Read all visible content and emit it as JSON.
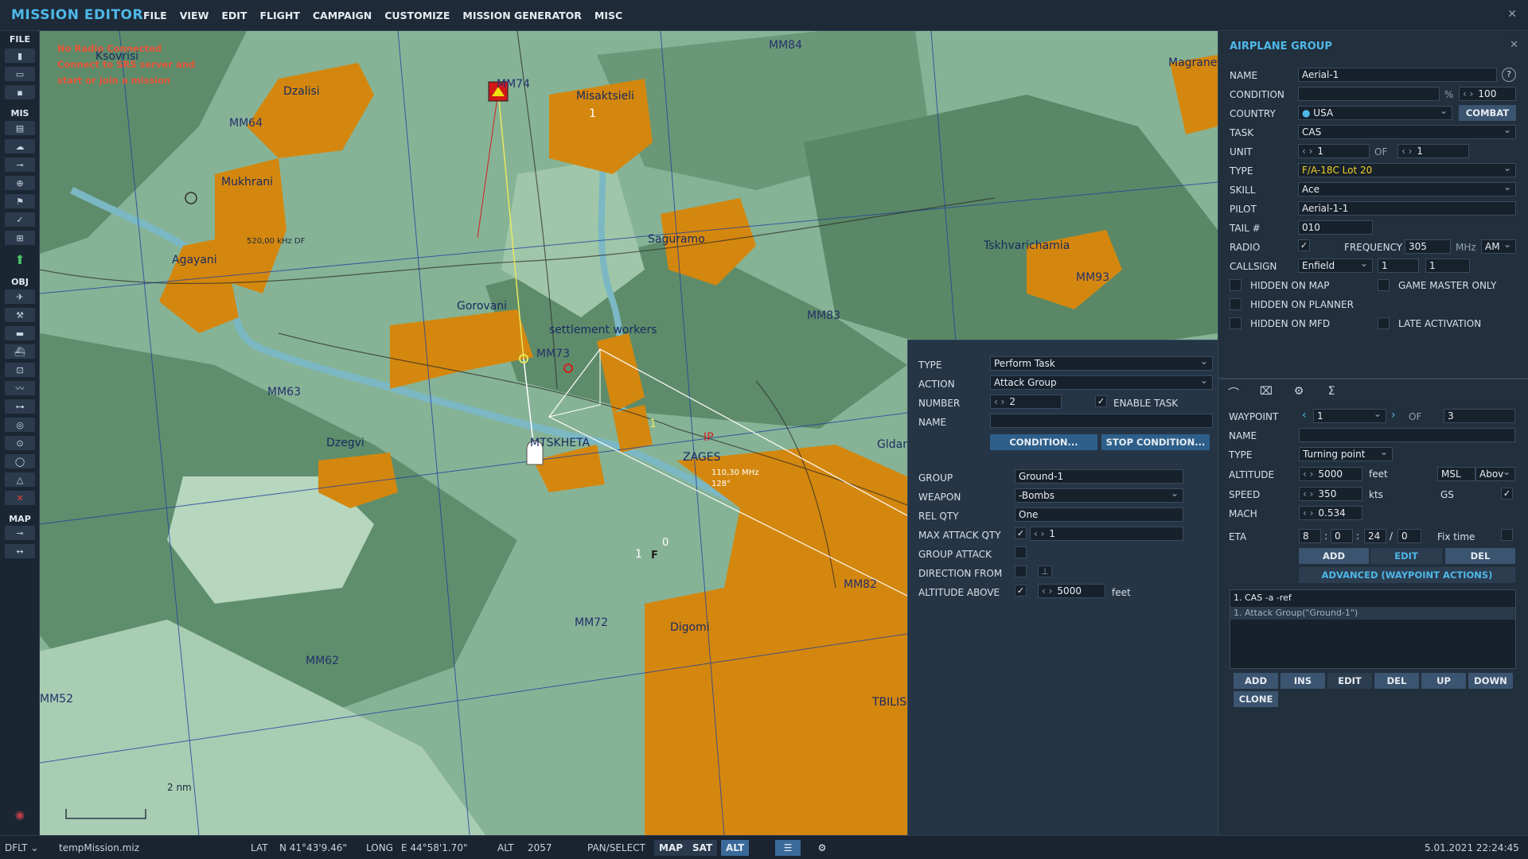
{
  "app": {
    "title": "MISSION EDITOR",
    "close_icon": "close-icon"
  },
  "menu": [
    "FILE",
    "VIEW",
    "EDIT",
    "FLIGHT",
    "CAMPAIGN",
    "CUSTOMIZE",
    "MISSION GENERATOR",
    "MISC"
  ],
  "toolbar": {
    "file_label": "FILE",
    "mis_label": "MIS",
    "obj_label": "OBJ",
    "map_label": "MAP"
  },
  "map": {
    "radio_msg_1": "No Radio Connected",
    "radio_msg_2": "Connect to SRS server and",
    "radio_msg_3": "start or join a mission",
    "towns": [
      "Ksovrisi",
      "Dzalisi",
      "Mukhrani",
      "Agayani",
      "Misaktsieli",
      "Saguramo",
      "Gorovani",
      "settlement workers",
      "Dzegvi",
      "MTSKHETA",
      "ZAGES",
      "Gldani",
      "Digomi",
      "TBILIS",
      "Magraneti",
      "Tskhvarichamia"
    ],
    "grid_labels": [
      "MM84",
      "MM74",
      "MM64",
      "MM83",
      "MM73",
      "MM63",
      "MM93",
      "MM82",
      "MM72",
      "MM62",
      "MM52"
    ],
    "beacon": "520,00 kHz DF",
    "ip_label": "IP",
    "zages_freq": "110,30 MHz",
    "zages_bearing": "128°",
    "wp1_label": "1",
    "wp0_label": "0",
    "start_label": "1",
    "target_label": "1",
    "f_label": "F",
    "scale": "2 nm"
  },
  "group_panel": {
    "title": "AIRPLANE GROUP",
    "name_label": "NAME",
    "name": "Aerial-1",
    "condition_label": "CONDITION",
    "condition": "",
    "percent": "%",
    "condition_pct": "100",
    "country_label": "COUNTRY",
    "country": "USA",
    "combat": "COMBAT",
    "task_label": "TASK",
    "task": "CAS",
    "unit_label": "UNIT",
    "unit": "1",
    "of_label": "OF",
    "unit_of": "1",
    "type_label": "TYPE",
    "type": "F/A-18C Lot 20",
    "skill_label": "SKILL",
    "skill": "Ace",
    "pilot_label": "PILOT",
    "pilot": "Aerial-1-1",
    "tail_label": "TAIL #",
    "tail": "010",
    "radio_label": "RADIO",
    "frequency_label": "FREQUENCY",
    "frequency": "305",
    "mhz": "MHz",
    "band": "AM",
    "callsign_label": "CALLSIGN",
    "callsign": "Enfield",
    "callsign_n1": "1",
    "callsign_n2": "1",
    "hidden_map": "HIDDEN ON MAP",
    "gm_only": "GAME MASTER ONLY",
    "hidden_planner": "HIDDEN ON PLANNER",
    "hidden_mfd": "HIDDEN ON MFD",
    "late_activation": "LATE ACTIVATION"
  },
  "waypoint_panel": {
    "waypoint_label": "WAYPOINT",
    "waypoint": "1",
    "of_label": "OF",
    "of_value": "3",
    "name_label": "NAME",
    "name": "",
    "type_label": "TYPE",
    "type": "Turning point",
    "altitude_label": "ALTITUDE",
    "altitude": "5000",
    "feet": "feet",
    "alt_ref": "MSL",
    "alt_mode": "Abov",
    "speed_label": "SPEED",
    "speed": "350",
    "kts": "kts",
    "gs": "GS",
    "mach_label": "MACH",
    "mach": "0.534",
    "eta_label": "ETA",
    "eta_d": "8",
    "eta_h": "0",
    "eta_m": "24",
    "eta_s": "0",
    "fix_time": "Fix time",
    "add": "ADD",
    "edit": "EDIT",
    "del": "DEL",
    "advanced": "ADVANCED (WAYPOINT ACTIONS)",
    "actions": [
      "1. CAS -a -ref",
      "1. Attack Group(\"Ground-1\")"
    ],
    "list_buttons": [
      "ADD",
      "INS",
      "EDIT",
      "DEL",
      "UP",
      "DOWN"
    ],
    "clone": "CLONE"
  },
  "task_panel": {
    "type_label": "TYPE",
    "type": "Perform Task",
    "action_label": "ACTION",
    "action": "Attack Group",
    "number_label": "NUMBER",
    "number": "2",
    "enable_task": "ENABLE TASK",
    "name_label": "NAME",
    "name": "",
    "condition_btn": "CONDITION...",
    "stop_condition_btn": "STOP CONDITION...",
    "group_label": "GROUP",
    "group": "Ground-1",
    "weapon_label": "WEAPON",
    "weapon": "-Bombs",
    "rel_qty_label": "REL QTY",
    "rel_qty": "One",
    "max_attack_label": "MAX ATTACK QTY",
    "max_attack": "1",
    "group_attack_label": "GROUP ATTACK",
    "direction_label": "DIRECTION FROM",
    "altitude_label": "ALTITUDE ABOVE",
    "altitude": "5000",
    "feet": "feet"
  },
  "status": {
    "profile": "DFLT",
    "file": "tempMission.miz",
    "lat_label": "LAT",
    "lat": "N 41°43'9.46\"",
    "long_label": "LONG",
    "long": "E 44°58'1.70\"",
    "alt_label": "ALT",
    "alt": "2057",
    "pan_select": "PAN/SELECT",
    "map_btn": "MAP",
    "sat_btn": "SAT",
    "alt_btn": "ALT",
    "datetime": "5.01.2021 22:24:45"
  },
  "colors": {
    "accent": "#4fb8e8",
    "urban": "#d4870e",
    "map_green": "#7aa88a"
  }
}
